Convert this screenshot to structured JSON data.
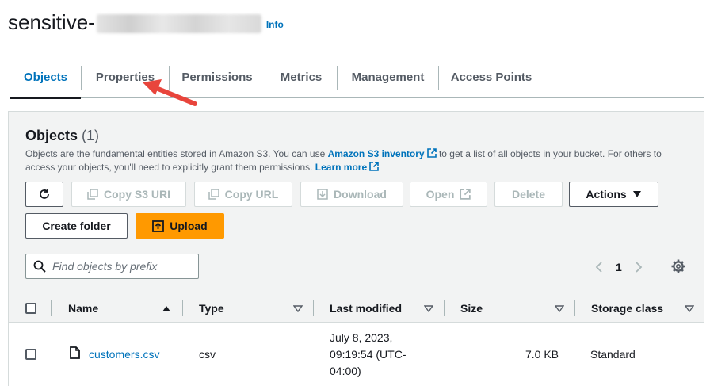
{
  "header": {
    "bucket_name": "sensitive-",
    "info_label": "Info"
  },
  "tabs": [
    {
      "label": "Objects",
      "active": true
    },
    {
      "label": "Properties",
      "active": false
    },
    {
      "label": "Permissions",
      "active": false
    },
    {
      "label": "Metrics",
      "active": false
    },
    {
      "label": "Management",
      "active": false
    },
    {
      "label": "Access Points",
      "active": false
    }
  ],
  "objects_panel": {
    "title": "Objects",
    "count": "(1)",
    "description_1": "Objects are the fundamental entities stored in Amazon S3. You can use ",
    "inventory_link": "Amazon S3 inventory",
    "description_2": " to get a list of all objects in your bucket. For others to access your objects, you'll need to explicitly grant them permissions. ",
    "learn_more_link": "Learn more"
  },
  "toolbar": {
    "refresh_icon": "refresh-icon",
    "copy_s3_uri": "Copy S3 URI",
    "copy_url": "Copy URL",
    "download": "Download",
    "open": "Open",
    "delete": "Delete",
    "actions": "Actions",
    "create_folder": "Create folder",
    "upload": "Upload"
  },
  "search": {
    "placeholder": "Find objects by prefix",
    "value": ""
  },
  "pagination": {
    "current_page": "1"
  },
  "table": {
    "columns": [
      "Name",
      "Type",
      "Last modified",
      "Size",
      "Storage class"
    ],
    "rows": [
      {
        "name": "customers.csv",
        "type": "csv",
        "last_modified_line1": "July 8, 2023,",
        "last_modified_line2": "09:19:54 (UTC-",
        "last_modified_line3": "04:00)",
        "size": "7.0 KB",
        "storage_class": "Standard"
      }
    ]
  },
  "colors": {
    "link": "#0073bb",
    "primary_button": "#ff9900",
    "annotation_arrow": "#e8453c",
    "panel_bg": "#f2f3f3"
  }
}
